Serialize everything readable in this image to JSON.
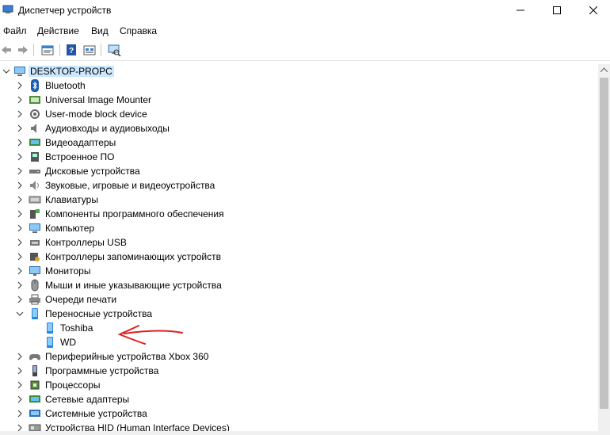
{
  "window": {
    "title": "Диспетчер устройств"
  },
  "menu": [
    "Файл",
    "Действие",
    "Вид",
    "Справка"
  ],
  "toolbar_icons": [
    "back-arrow-icon",
    "forward-arrow-icon",
    "properties-icon",
    "help-icon",
    "show-hidden-icon",
    "scan-hardware-icon"
  ],
  "tree": {
    "root": "DESKTOP-PROPC",
    "items": [
      {
        "label": "Bluetooth",
        "icon": "bluetooth-icon",
        "expanded": false
      },
      {
        "label": "Universal Image Mounter",
        "icon": "image-mounter-icon",
        "expanded": false
      },
      {
        "label": "User-mode block device",
        "icon": "block-device-icon",
        "expanded": false
      },
      {
        "label": "Аудиовходы и аудиовыходы",
        "icon": "speaker-icon",
        "expanded": false
      },
      {
        "label": "Видеоадаптеры",
        "icon": "display-adapter-icon",
        "expanded": false
      },
      {
        "label": "Встроенное ПО",
        "icon": "firmware-icon",
        "expanded": false
      },
      {
        "label": "Дисковые устройства",
        "icon": "disk-drive-icon",
        "expanded": false
      },
      {
        "label": "Звуковые, игровые и видеоустройства",
        "icon": "sound-icon",
        "expanded": false
      },
      {
        "label": "Клавиатуры",
        "icon": "keyboard-icon",
        "expanded": false
      },
      {
        "label": "Компоненты программного обеспечения",
        "icon": "software-component-icon",
        "expanded": false
      },
      {
        "label": "Компьютер",
        "icon": "computer-icon",
        "expanded": false
      },
      {
        "label": "Контроллеры USB",
        "icon": "usb-icon",
        "expanded": false
      },
      {
        "label": "Контроллеры запоминающих устройств",
        "icon": "storage-controller-icon",
        "expanded": false
      },
      {
        "label": "Мониторы",
        "icon": "monitor-icon",
        "expanded": false
      },
      {
        "label": "Мыши и иные указывающие устройства",
        "icon": "mouse-icon",
        "expanded": false
      },
      {
        "label": "Очереди печати",
        "icon": "printer-icon",
        "expanded": false
      },
      {
        "label": "Переносные устройства",
        "icon": "portable-device-icon",
        "expanded": true,
        "children": [
          {
            "label": "Toshiba",
            "icon": "portable-device-icon"
          },
          {
            "label": "WD",
            "icon": "portable-device-icon"
          }
        ]
      },
      {
        "label": "Периферийные устройства Xbox 360",
        "icon": "xbox-peripheral-icon",
        "expanded": false
      },
      {
        "label": "Программные устройства",
        "icon": "software-device-icon",
        "expanded": false
      },
      {
        "label": "Процессоры",
        "icon": "processor-icon",
        "expanded": false
      },
      {
        "label": "Сетевые адаптеры",
        "icon": "network-adapter-icon",
        "expanded": false
      },
      {
        "label": "Системные устройства",
        "icon": "system-device-icon",
        "expanded": false
      },
      {
        "label": "Устройства HID (Human Interface Devices)",
        "icon": "hid-icon",
        "expanded": false
      }
    ]
  },
  "colors": {
    "accent": "#0078d7",
    "selection": "#cce8ff",
    "annotation": "#e02020"
  }
}
